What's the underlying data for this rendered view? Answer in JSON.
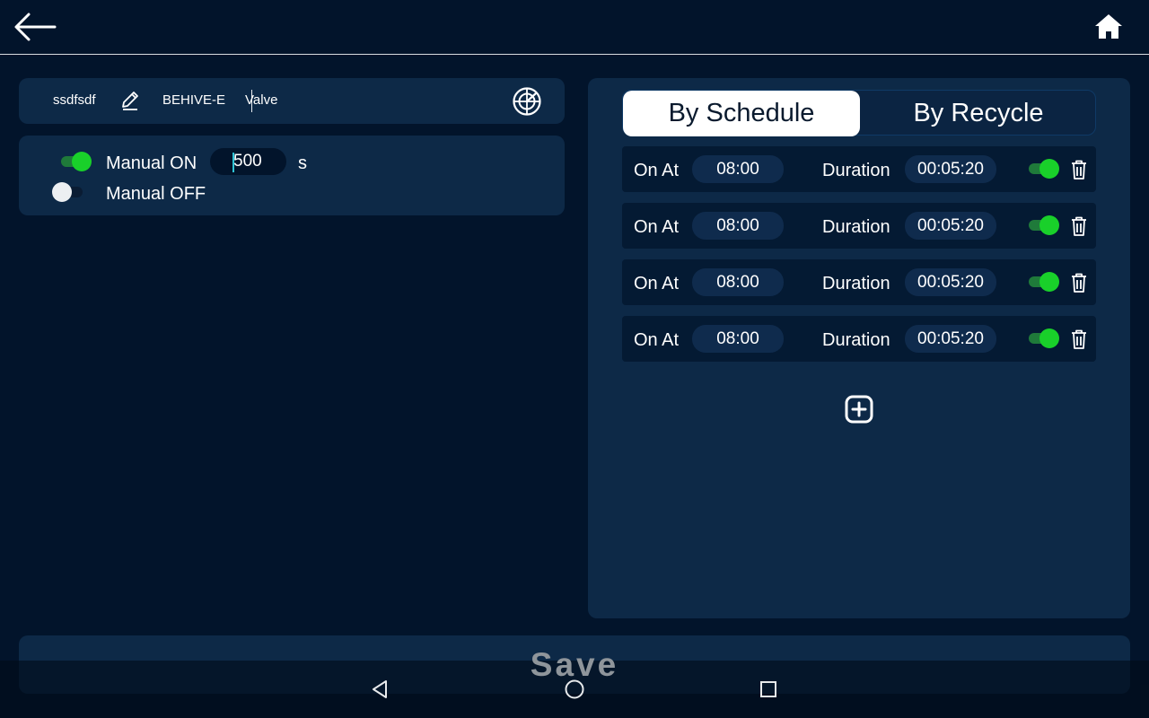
{
  "header": {
    "back_icon": "arrow-left-icon",
    "home_icon": "home-icon"
  },
  "device": {
    "name": "ssdfsdf",
    "edit_icon": "pencil-icon",
    "model": "BEHIVE-E",
    "type": "Valve",
    "radar_icon": "radar-icon"
  },
  "manual": {
    "on_label": "Manual ON",
    "on_state": true,
    "seconds_value": "500",
    "unit": "s",
    "off_label": "Manual OFF",
    "off_state": false
  },
  "mode_tabs": {
    "schedule": "By Schedule",
    "recycle": "By Recycle",
    "active": "schedule"
  },
  "schedules": [
    {
      "on_label": "On At",
      "time": "08:00",
      "duration_label": "Duration",
      "duration": "00:05:20",
      "enabled": true
    },
    {
      "on_label": "On At",
      "time": "08:00",
      "duration_label": "Duration",
      "duration": "00:05:20",
      "enabled": true
    },
    {
      "on_label": "On At",
      "time": "08:00",
      "duration_label": "Duration",
      "duration": "00:05:20",
      "enabled": true
    },
    {
      "on_label": "On At",
      "time": "08:00",
      "duration_label": "Duration",
      "duration": "00:05:20",
      "enabled": true
    }
  ],
  "add_icon": "plus-square-icon",
  "save_label": "Save",
  "android_nav": {
    "back": "triangle-back-icon",
    "home": "circle-home-icon",
    "recents": "square-recents-icon"
  },
  "colors": {
    "background": "#02142b",
    "panel": "#0d2947",
    "toggle_on": "#19d02a",
    "text": "#ffffff"
  }
}
